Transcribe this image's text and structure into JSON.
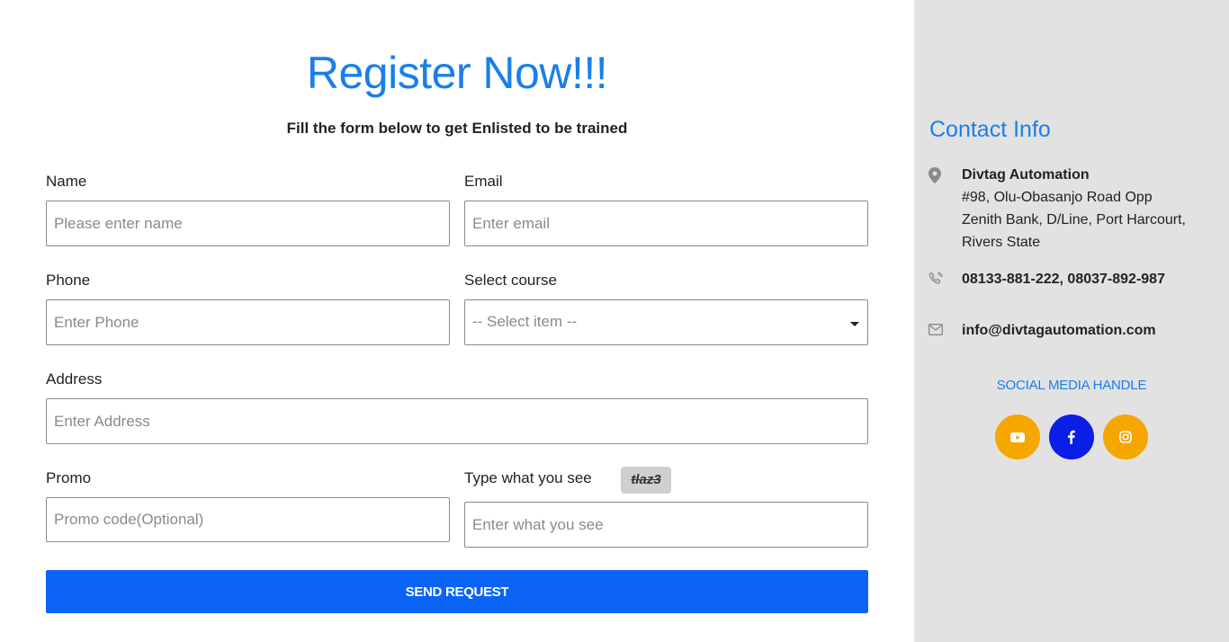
{
  "form": {
    "title": "Register Now!!!",
    "subtitle": "Fill the form below to get Enlisted to be trained",
    "name_label": "Name",
    "name_placeholder": "Please enter name",
    "email_label": "Email",
    "email_placeholder": "Enter email",
    "phone_label": "Phone",
    "phone_placeholder": "Enter Phone",
    "course_label": "Select course",
    "course_selected": "-- Select item --",
    "address_label": "Address",
    "address_placeholder": "Enter Address",
    "promo_label": "Promo",
    "promo_placeholder": "Promo code(Optional)",
    "captcha_label": "Type what you see",
    "captcha_code": "tlaz3",
    "captcha_placeholder": "Enter what you see",
    "submit_label": "SEND REQUEST"
  },
  "contact": {
    "title": "Contact Info",
    "company": "Divtag Automation",
    "address_line1": "#98, Olu-Obasanjo Road Opp",
    "address_line2": "Zenith Bank, D/Line, Port Harcourt,",
    "address_line3": "Rivers State",
    "phones": "08133-881-222, 08037-892-987",
    "email": "info@divtagautomation.com",
    "social_title": "SOCIAL MEDIA HANDLE",
    "icons": {
      "location": "map-pin-icon",
      "phone": "phone-icon",
      "email": "envelope-icon"
    }
  },
  "social": [
    {
      "name": "youtube-icon",
      "color": "#f5a700"
    },
    {
      "name": "facebook-icon",
      "color": "#0a1ee6"
    },
    {
      "name": "instagram-icon",
      "color": "#f5a700"
    }
  ],
  "colors": {
    "accent": "#1a7fe8",
    "button": "#0b63f6",
    "sidebar_bg": "#e2e2e2"
  }
}
